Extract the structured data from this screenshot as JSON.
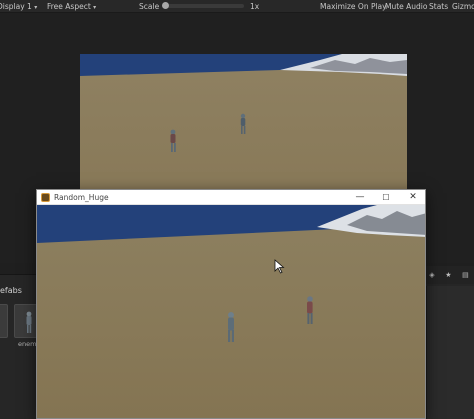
{
  "toolbar": {
    "display": "Display 1",
    "aspect": "Free Aspect",
    "scale_label": "Scale",
    "scale_value": "1x",
    "maximize_on_play": "Maximize On Play",
    "mute_audio": "Mute Audio",
    "stats": "Stats",
    "gizmos": "Gizmos"
  },
  "project": {
    "folder_label": "efabs",
    "prefab_name": "enem"
  },
  "player_window": {
    "title": "Random_Huge",
    "minimize_glyph": "—",
    "maximize_glyph": "☐",
    "close_glyph": "✕"
  },
  "colors": {
    "sky": "#23417a",
    "ground": "#8b7c56",
    "editor_bg": "#202020",
    "toolbar_bg": "#282828"
  },
  "icons": [
    "scale-slider-thumb",
    "app-icon",
    "mouse-cursor-icon",
    "caret-down-icon"
  ]
}
